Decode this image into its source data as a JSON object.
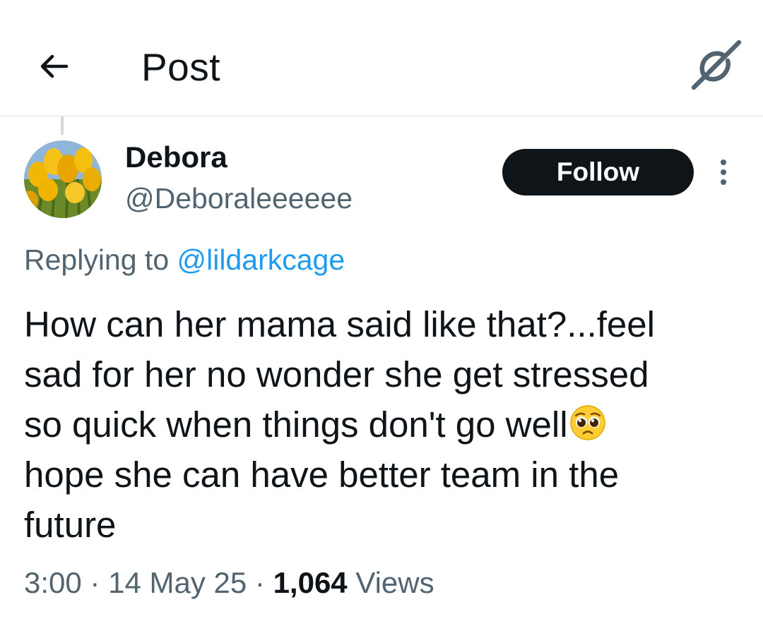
{
  "header": {
    "title": "Post",
    "back_icon": "arrow-left-icon",
    "grok_icon": "grok-icon"
  },
  "author": {
    "name": "Debora",
    "handle": "@Deboraleeeeee",
    "avatar": "yellow-tulips-avatar"
  },
  "follow_button": {
    "label": "Follow"
  },
  "more_icon": "more-vertical-icon",
  "reply": {
    "prefix": "Replying to",
    "handle": "@lildarkcage"
  },
  "tweet": {
    "lines": [
      "How can her mama said like that?...feel",
      "sad for her no wonder she get stressed",
      "so quick when things don't go well",
      "hope she can have better team in the",
      "future"
    ],
    "emoji": "pleading-face-emoji"
  },
  "meta": {
    "time": "3:00",
    "separator": "·",
    "date": "14 May 25",
    "views_count": "1,064",
    "views_label": "Views"
  },
  "colors": {
    "text_primary": "#0f1419",
    "text_secondary": "#536471",
    "link": "#1d9bf0",
    "follow_bg": "#0f1419",
    "divider": "#e1e6ea"
  }
}
